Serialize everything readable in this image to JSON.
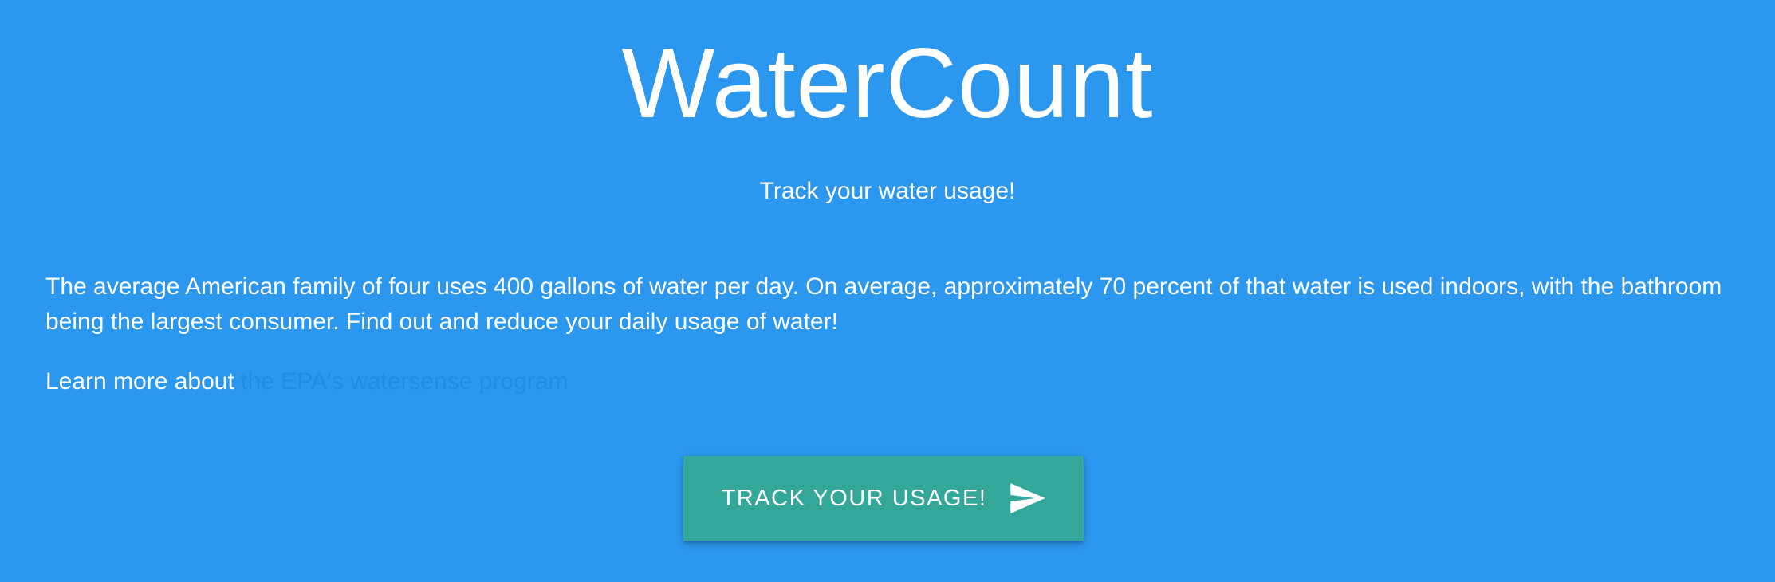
{
  "header": {
    "title": "WaterCount",
    "subtitle": "Track your water usage!"
  },
  "main": {
    "intro": "The average American family of four uses 400 gallons of water per day. On average, approximately 70 percent of that water is used indoors, with the bathroom being the largest consumer. Find out and reduce your daily usage of water!",
    "learn_more_prefix": "Learn more about",
    "learn_more_link": "the EPA's watersense program"
  },
  "cta": {
    "label": "TRACK YOUR USAGE!",
    "icon": "send-icon"
  },
  "colors": {
    "background": "#2c97ef",
    "button": "#32a79a",
    "link": "#1c8fe0",
    "text": "#ffffff"
  }
}
